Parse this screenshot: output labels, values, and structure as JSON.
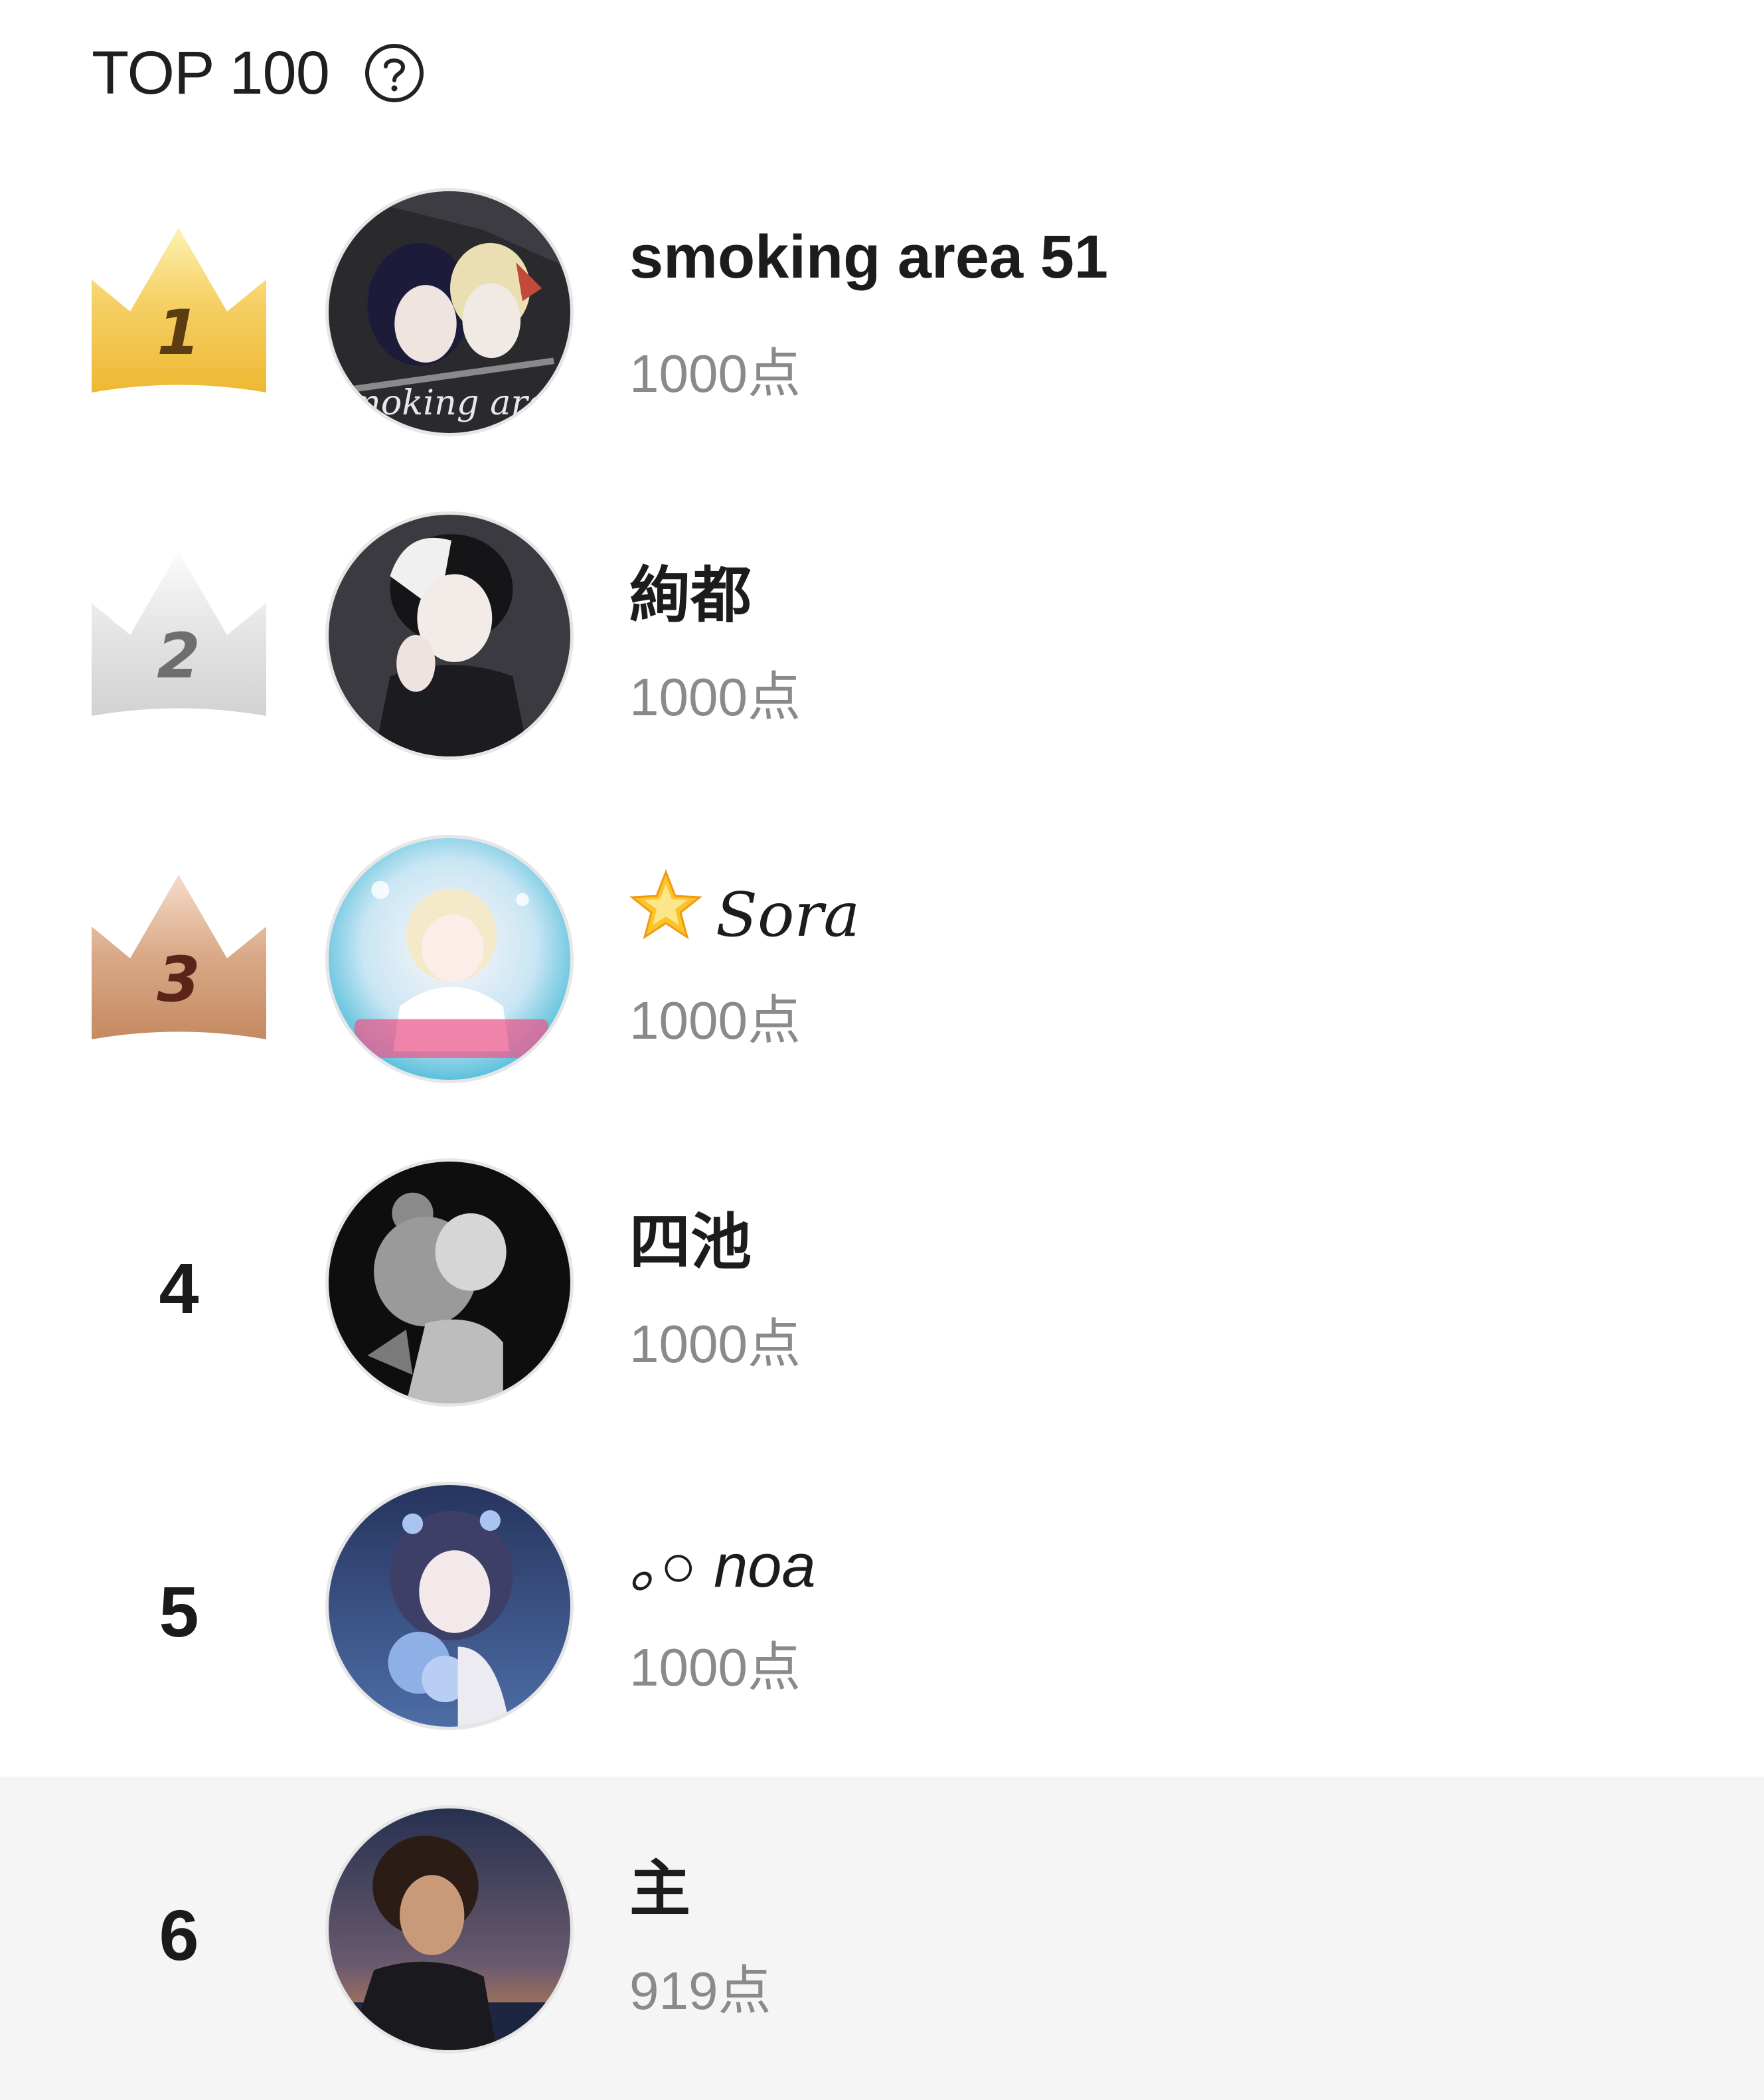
{
  "header": {
    "title": "TOP 100",
    "help_icon": "question-circle-icon"
  },
  "ranking": [
    {
      "rank": "1",
      "badge": "gold-crown",
      "badge_color": "#f3c44a",
      "name": "smoking area 51",
      "score": "1000点",
      "avatar_text": "smoking area"
    },
    {
      "rank": "2",
      "badge": "silver-crown",
      "badge_color": "#d8d8d8",
      "name": "絢都",
      "score": "1000点"
    },
    {
      "rank": "3",
      "badge": "bronze-crown",
      "badge_color": "#c9916c",
      "name_prefix_icon": "glowing-star-icon",
      "name": "Sora",
      "score": "1000点"
    },
    {
      "rank": "4",
      "name": "四池",
      "score": "1000点"
    },
    {
      "rank": "5",
      "name": "｡○ noa",
      "score": "1000点"
    },
    {
      "rank": "6",
      "name": "主",
      "score": "919点",
      "highlighted": true
    }
  ]
}
